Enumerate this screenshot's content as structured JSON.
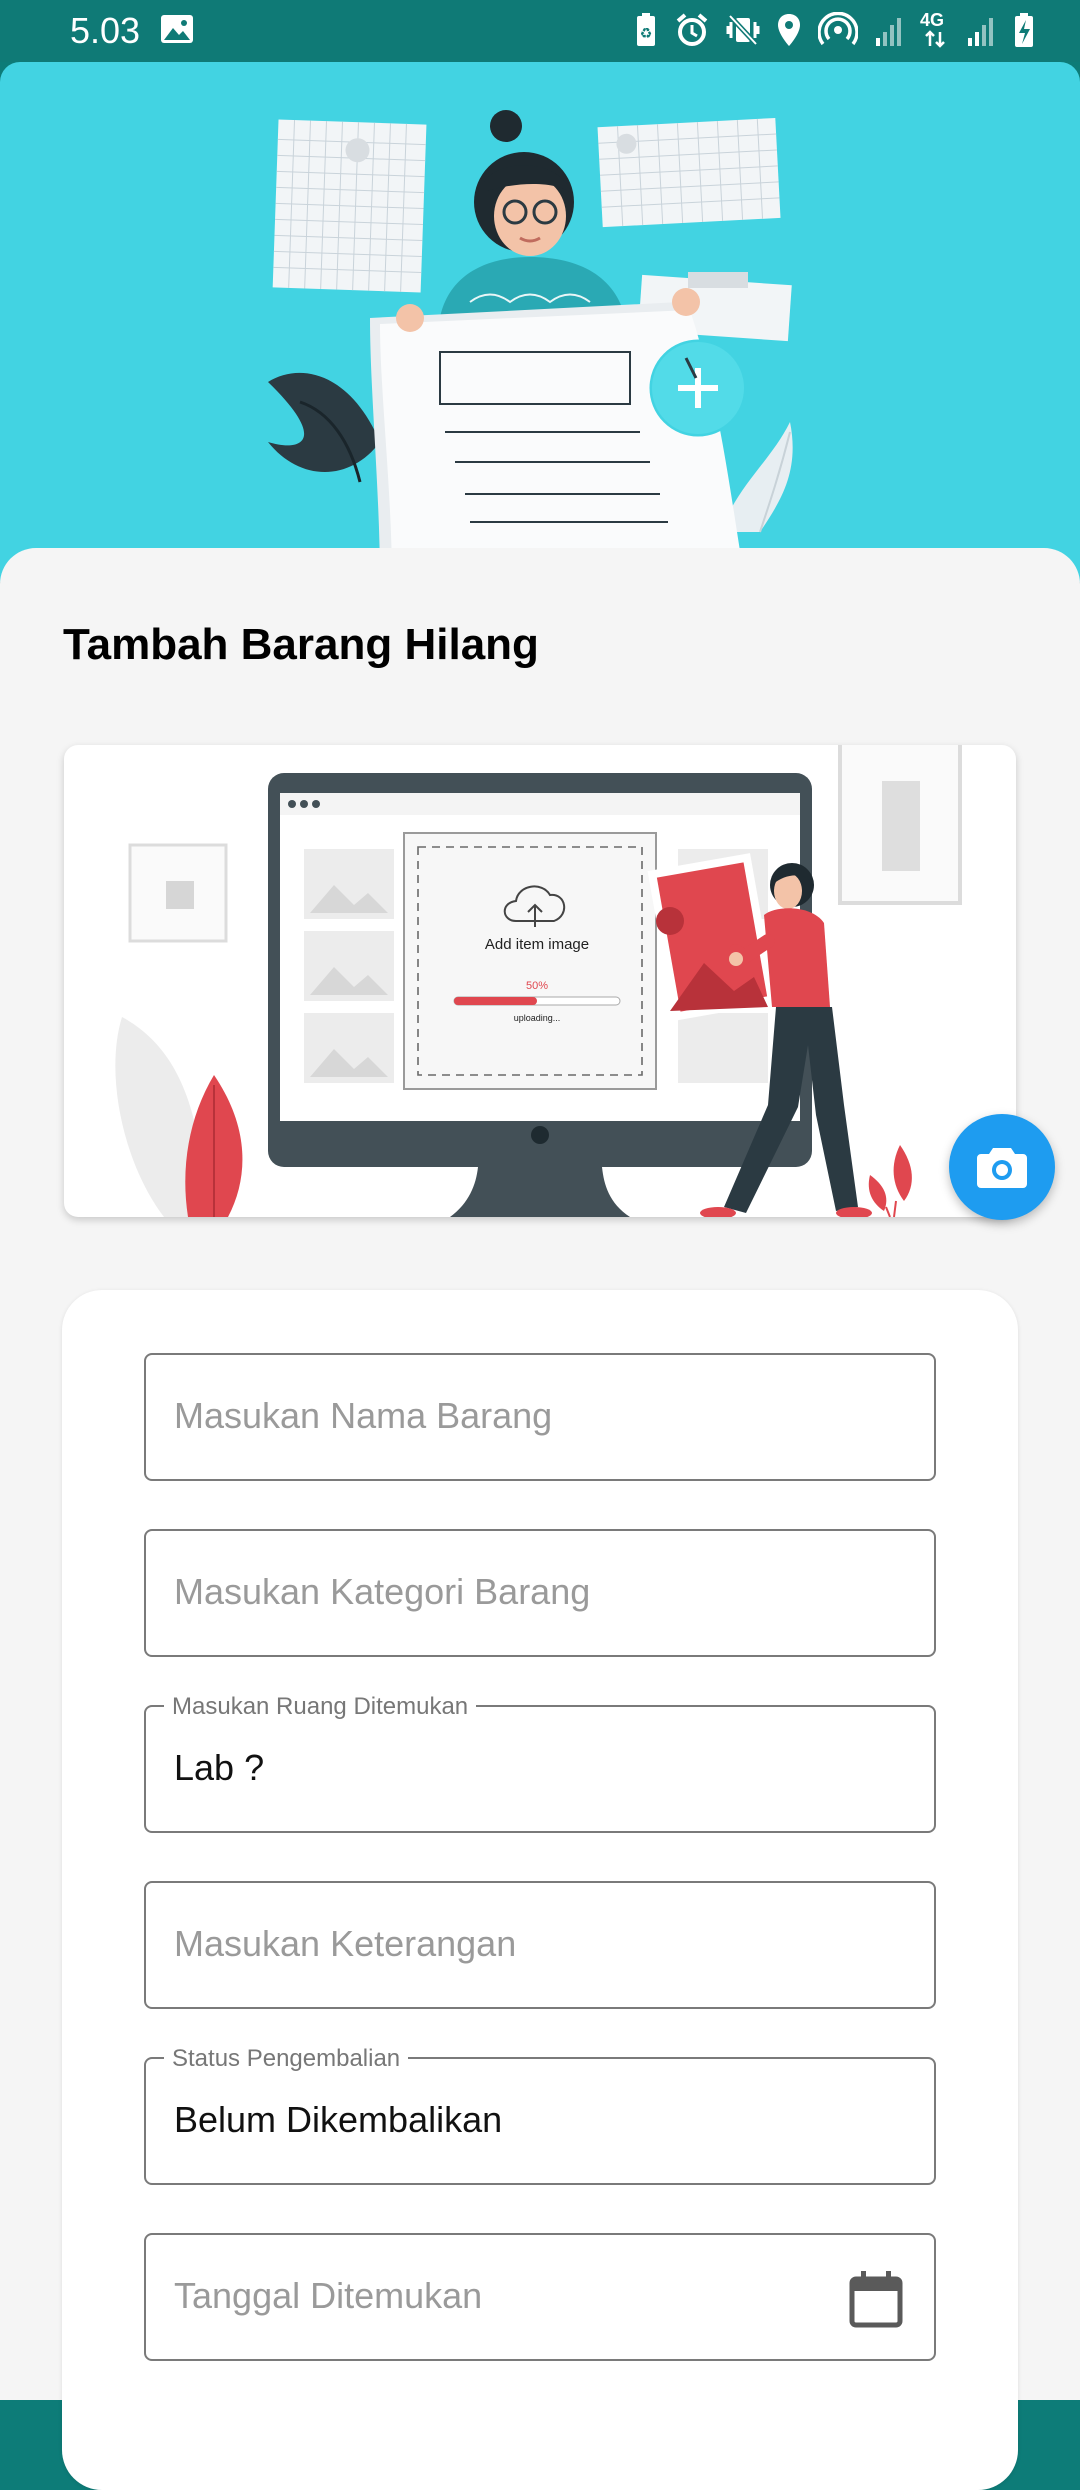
{
  "status_bar": {
    "time": "5.03",
    "network": "4G"
  },
  "page": {
    "title": "Tambah Barang Hilang"
  },
  "upload_illustration": {
    "caption": "Add item image",
    "progress_text": "50%",
    "progress": 0.5,
    "status": "uploading..."
  },
  "form": {
    "nama_barang": {
      "placeholder": "Masukan Nama Barang",
      "value": ""
    },
    "kategori_barang": {
      "placeholder": "Masukan Kategori Barang",
      "value": ""
    },
    "ruang_ditemukan": {
      "label": "Masukan Ruang Ditemukan",
      "value": "Lab ?"
    },
    "keterangan": {
      "placeholder": "Masukan Keterangan",
      "value": ""
    },
    "status_pengembalian": {
      "label": "Status Pengembalian",
      "value": "Belum Dikembalikan"
    },
    "tanggal_ditemukan": {
      "placeholder": "Tanggal Ditemukan",
      "value": ""
    }
  },
  "colors": {
    "status_bar": "#0f7a76",
    "hero_bg": "#42d3e2",
    "fab": "#1e9cf0",
    "accent_red": "#e0474f"
  }
}
